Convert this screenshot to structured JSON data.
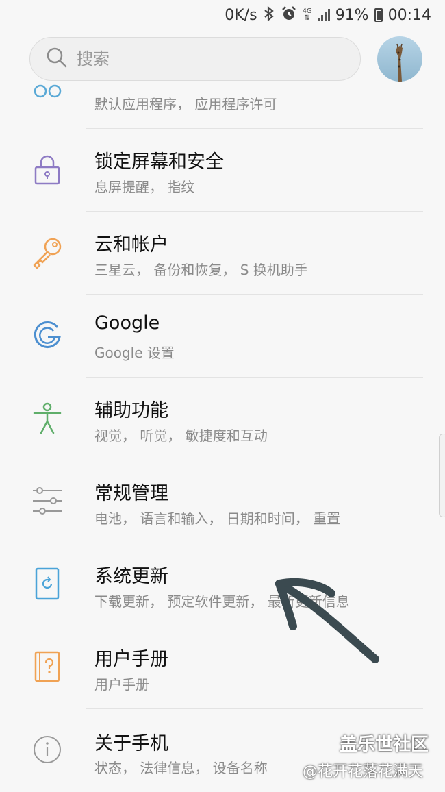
{
  "status_bar": {
    "speed": "0K/s",
    "network": "4G",
    "battery": "91%",
    "time": "00:14"
  },
  "search": {
    "placeholder": "搜索"
  },
  "settings": [
    {
      "title": "",
      "subtitle": "默认应用程序， 应用程序许可",
      "icon": "apps-icon"
    },
    {
      "title": "锁定屏幕和安全",
      "subtitle": "息屏提醒， 指纹",
      "icon": "lock-icon"
    },
    {
      "title": "云和帐户",
      "subtitle": "三星云， 备份和恢复， S 换机助手",
      "icon": "key-icon"
    },
    {
      "title": "Google",
      "subtitle": "Google 设置",
      "icon": "google-icon"
    },
    {
      "title": "辅助功能",
      "subtitle": "视觉， 听觉， 敏捷度和互动",
      "icon": "accessibility-icon"
    },
    {
      "title": "常规管理",
      "subtitle": "电池， 语言和输入， 日期和时间， 重置",
      "icon": "sliders-icon"
    },
    {
      "title": "系统更新",
      "subtitle": "下载更新， 预定软件更新， 最新更新信息",
      "icon": "system-update-icon"
    },
    {
      "title": "用户手册",
      "subtitle": "用户手册",
      "icon": "manual-icon"
    },
    {
      "title": "关于手机",
      "subtitle": "状态， 法律信息， 设备名称",
      "icon": "info-icon"
    }
  ],
  "watermark": {
    "brand": "盖乐世社区",
    "user": "@花开花落花满天"
  }
}
